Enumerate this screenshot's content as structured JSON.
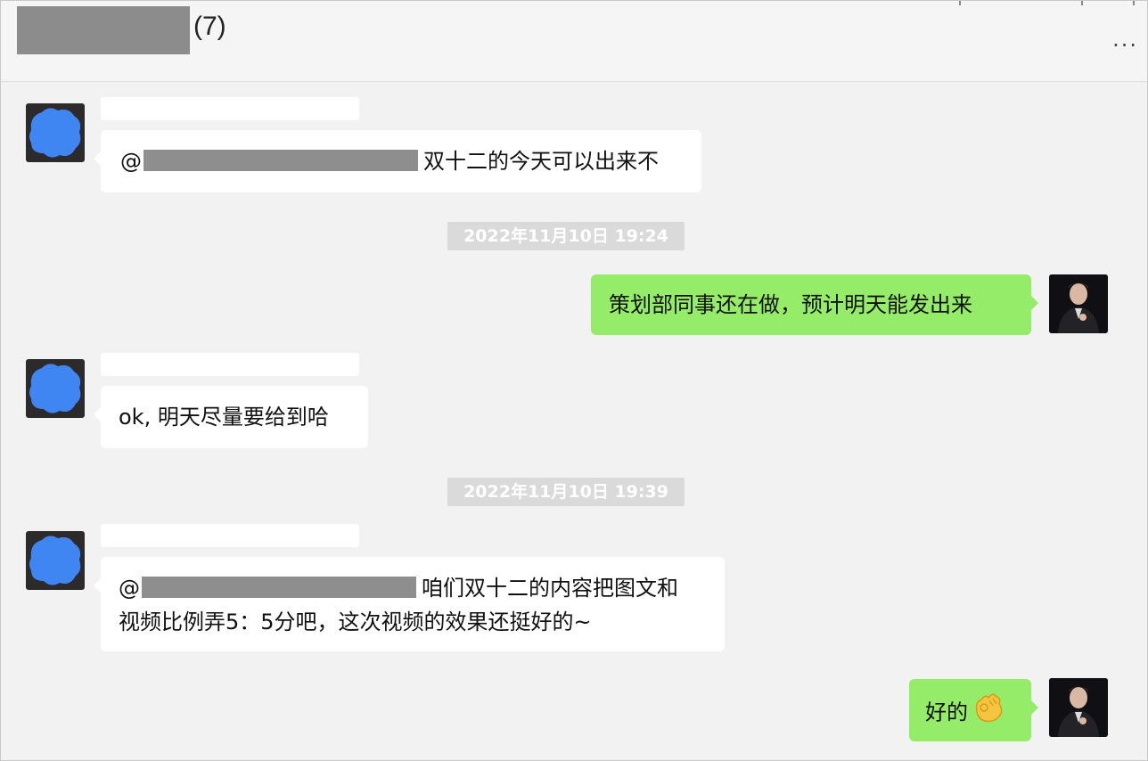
{
  "header": {
    "group_count": "(7)",
    "more_label": "···"
  },
  "messages": [
    {
      "sender": "other",
      "mention": "@",
      "text": "双十二的今天可以出来不"
    },
    {
      "type": "time",
      "text": "2022年11月10日 19:24"
    },
    {
      "sender": "me",
      "text": "策划部同事还在做，预计明天能发出来"
    },
    {
      "sender": "other",
      "text": "ok, 明天尽量要给到哈"
    },
    {
      "type": "time",
      "text": "2022年11月10日 19:39"
    },
    {
      "sender": "other",
      "mention": "@",
      "text_line1": "咱们双十二的内容把图文和",
      "text_line2": "视频比例弄5：5分吧，这次视频的效果还挺好的~"
    },
    {
      "sender": "me",
      "text": "好的",
      "emoji": "ok-hand-icon"
    }
  ],
  "colors": {
    "background": "#f2f2f2",
    "my_bubble": "#95ec69",
    "their_bubble": "#ffffff",
    "timestamp_bg": "#dadada"
  }
}
